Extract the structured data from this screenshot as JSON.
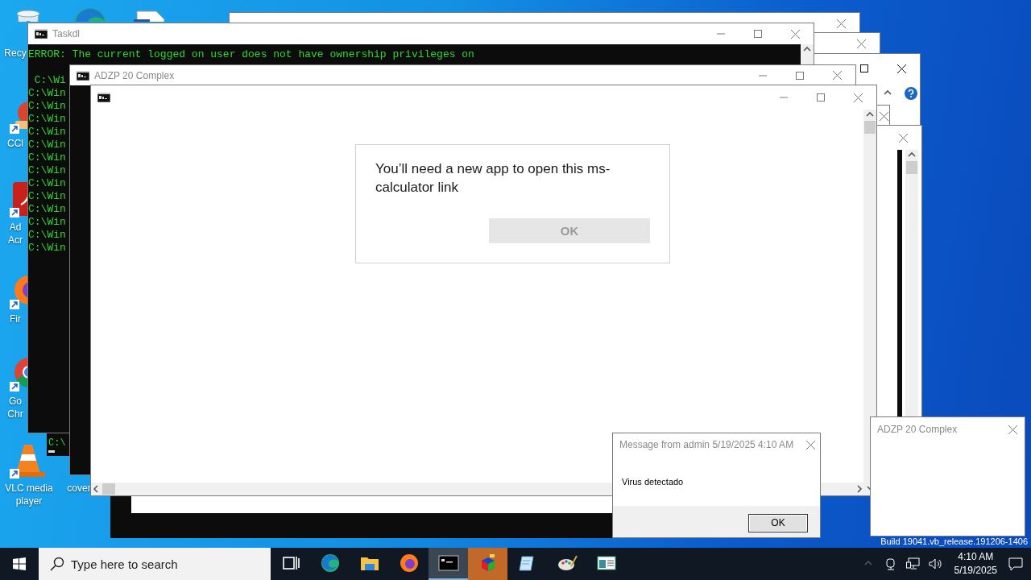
{
  "desktop_icons": [
    {
      "kind": "bin",
      "lines": [
        "Recy"
      ]
    },
    {
      "kind": "edge"
    },
    {
      "kind": "document"
    },
    {
      "kind": "ccleaner",
      "lines": [
        "CCl"
      ]
    },
    {
      "kind": "adobe",
      "lines": [
        "Ad",
        "Acr"
      ]
    },
    {
      "kind": "firefox",
      "lines": [
        "Fir"
      ]
    },
    {
      "kind": "chrome",
      "lines": [
        "Go",
        "Chr"
      ]
    },
    {
      "kind": "vlc",
      "lines": [
        "VLC media",
        "player"
      ]
    },
    {
      "kind": "hidden",
      "lines": [
        "cover"
      ]
    }
  ],
  "taskdl_window": {
    "title": "Taskdl",
    "error": "ERROR: The current logged on user does not have ownership privileges on",
    "lines": [
      " C:\\Wi",
      "C:\\Win",
      "C:\\Win",
      "C:\\Win",
      "C:\\Win",
      "C:\\Win",
      "C:\\Win",
      "C:\\Win",
      "C:\\Win",
      "C:\\Win",
      "C:\\Win",
      "C:\\Win",
      "C:\\Win",
      "C:\\Win"
    ]
  },
  "lower_console": {
    "text": "C:\\"
  },
  "adzp_window": {
    "title": "ADZP 20 Complex"
  },
  "app_dialog": {
    "message": "You’ll need a new app to open this ms-calculator link",
    "button": {
      "label": "OK",
      "disabled": true
    }
  },
  "message_box": {
    "title": "Message from admin 5/19/2025 4:10 AM",
    "body": "Virus detectado",
    "button": "OK"
  },
  "adzp_window_small": {
    "title": "ADZP 20 Complex"
  },
  "build_text": "Build 19041.vb_release.191206-1406",
  "taskbar": {
    "search": {
      "placeholder": "Type here to search"
    },
    "apps": [
      {
        "kind": "task-view",
        "selected": false,
        "flashing": false
      },
      {
        "kind": "edge",
        "selected": false,
        "flashing": false
      },
      {
        "kind": "explorer",
        "selected": false,
        "flashing": false
      },
      {
        "kind": "firefox",
        "selected": false,
        "flashing": false
      },
      {
        "kind": "console",
        "selected": true,
        "flashing": false
      },
      {
        "kind": "cube",
        "selected": false,
        "flashing": true
      },
      {
        "kind": "notepad",
        "selected": false,
        "flashing": false
      },
      {
        "kind": "paint",
        "selected": false,
        "flashing": false
      },
      {
        "kind": "window",
        "selected": false,
        "flashing": false
      }
    ],
    "clock": {
      "time": "4:10 AM",
      "date": "5/19/2025"
    }
  }
}
